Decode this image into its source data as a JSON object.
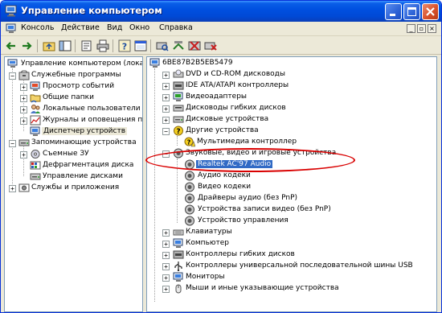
{
  "window": {
    "title": "Управление компьютером",
    "accent": "#0a5ee8"
  },
  "menu": {
    "items": [
      "Консоль",
      "Действие",
      "Вид",
      "Окно",
      "Справка"
    ]
  },
  "toolbar": {
    "icons": [
      "back-icon",
      "forward-icon",
      "up-folder-icon",
      "show-tree-icon",
      "properties-icon",
      "print-icon",
      "help-icon",
      "console-icon",
      "scan-hardware-icon",
      "update-driver-icon",
      "disable-icon",
      "uninstall-icon"
    ]
  },
  "left_tree": {
    "root": "Управление компьютером (локаль",
    "system_tools": "Служебные программы",
    "event_viewer": "Просмотр событий",
    "shared_folders": "Общие папки",
    "local_users": "Локальные пользователи",
    "perf_logs": "Журналы и оповещения пр",
    "device_manager": "Диспетчер устройств",
    "storage": "Запоминающие устройства",
    "removable": "Съемные ЗУ",
    "defrag": "Дефрагментация диска",
    "disk_mgmt": "Управление дисками",
    "services_apps": "Службы и приложения"
  },
  "right_tree": {
    "computer": "6BE87B2B5EB5479",
    "dvd": "DVD и CD-ROM дисководы",
    "ide": "IDE ATA/ATAPI контроллеры",
    "video": "Видеоадаптеры",
    "floppy_drives": "Дисководы гибких дисков",
    "disk_drives": "Дисковые устройства",
    "other": "Другие устройства",
    "multimedia": "Мультимедиа контроллер",
    "sound": "Звуковые, видео и игровые устройства",
    "realtek": "Realtek AC'97 Audio",
    "audio_codecs": "Аудио кодеки",
    "video_codecs": "Видео кодеки",
    "pnp_audio": "Драйверы аудио (без PnP)",
    "video_capture": "Устройства записи видео (без PnP)",
    "media_control": "Устройство управления",
    "keyboards": "Клавиатуры",
    "computer_node": "Компьютер",
    "floppy_ctrl": "Контроллеры гибких дисков",
    "usb": "Контроллеры универсальной последовательной шины USB",
    "monitors": "Мониторы",
    "mice": "Мыши и иные указывающие устройства"
  },
  "colors": {
    "selection": "#316ac5",
    "annotation": "#d90000"
  }
}
